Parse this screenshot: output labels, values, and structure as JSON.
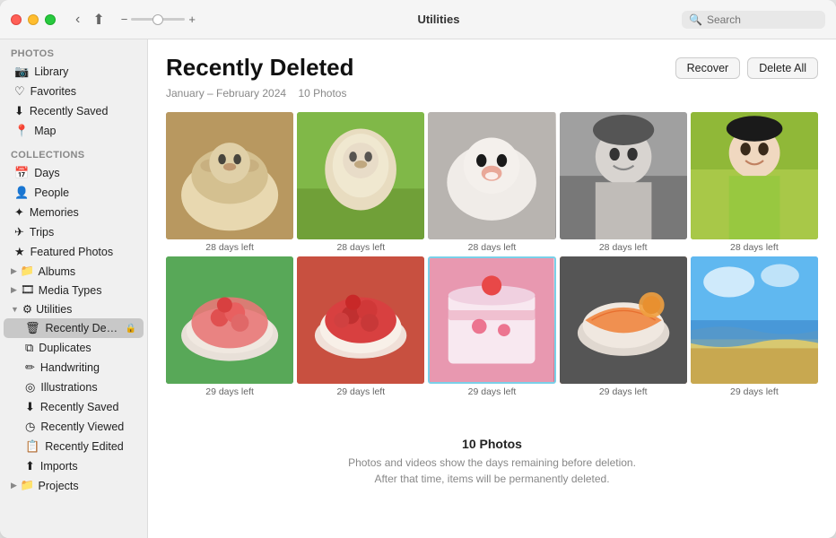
{
  "window": {
    "title": "Utilities"
  },
  "titlebar": {
    "back_btn": "‹",
    "share_btn": "⬆",
    "zoom_minus": "−",
    "zoom_plus": "+",
    "title": "Utilities",
    "search_placeholder": "Search"
  },
  "sidebar": {
    "photos_section": "Photos",
    "collections_section": "Collections",
    "photos_items": [
      {
        "id": "library",
        "icon": "📷",
        "label": "Library"
      },
      {
        "id": "favorites",
        "icon": "♡",
        "label": "Favorites"
      },
      {
        "id": "recently-saved",
        "icon": "⬇",
        "label": "Recently Saved"
      },
      {
        "id": "map",
        "icon": "📍",
        "label": "Map"
      }
    ],
    "collections_items": [
      {
        "id": "days",
        "icon": "📅",
        "label": "Days"
      },
      {
        "id": "people",
        "icon": "👤",
        "label": "People"
      },
      {
        "id": "memories",
        "icon": "✦",
        "label": "Memories"
      },
      {
        "id": "trips",
        "icon": "✈",
        "label": "Trips"
      },
      {
        "id": "featured-photos",
        "icon": "★",
        "label": "Featured Photos"
      },
      {
        "id": "albums",
        "icon": "📁",
        "label": "Albums",
        "has_toggle": true
      },
      {
        "id": "media-types",
        "icon": "🎞",
        "label": "Media Types",
        "has_toggle": true
      },
      {
        "id": "utilities",
        "icon": "⚙",
        "label": "Utilities",
        "expanded": true
      }
    ],
    "utilities_subitems": [
      {
        "id": "recently-deleted",
        "icon": "🗑",
        "label": "Recently Delet...",
        "active": true,
        "has_lock": true
      },
      {
        "id": "duplicates",
        "icon": "⧉",
        "label": "Duplicates"
      },
      {
        "id": "handwriting",
        "icon": "✏",
        "label": "Handwriting"
      },
      {
        "id": "illustrations",
        "icon": "◎",
        "label": "Illustrations"
      },
      {
        "id": "recently-saved-sub",
        "icon": "⬇",
        "label": "Recently Saved"
      },
      {
        "id": "recently-viewed",
        "icon": "◷",
        "label": "Recently Viewed"
      },
      {
        "id": "recently-edited",
        "icon": "📋",
        "label": "Recently Edited"
      },
      {
        "id": "imports",
        "icon": "⬆",
        "label": "Imports"
      }
    ],
    "projects_item": {
      "id": "projects",
      "icon": "📁",
      "label": "Projects",
      "has_toggle": true
    }
  },
  "content": {
    "title": "Recently Deleted",
    "subtitle": "January – February 2024",
    "photo_count_inline": "10 Photos",
    "recover_btn": "Recover",
    "delete_all_btn": "Delete All",
    "photos": [
      {
        "id": "p1",
        "days": "28 days left",
        "color_class": "dog-mop-floor"
      },
      {
        "id": "p2",
        "days": "28 days left",
        "color_class": "dog-mop-green"
      },
      {
        "id": "p3",
        "days": "28 days left",
        "color_class": "dog-mop-gray"
      },
      {
        "id": "p4",
        "days": "28 days left",
        "color_class": "girl-bw"
      },
      {
        "id": "p5",
        "days": "28 days left",
        "color_class": "girl-green"
      },
      {
        "id": "p6",
        "days": "29 days left",
        "color_class": "bowl-green"
      },
      {
        "id": "p7",
        "days": "29 days left",
        "color_class": "bowl-red"
      },
      {
        "id": "p8",
        "days": "29 days left",
        "color_class": "bowl-pink"
      },
      {
        "id": "p9",
        "days": "29 days left",
        "color_class": "bowl-orange"
      },
      {
        "id": "p10",
        "days": "29 days left",
        "color_class": "beach-blue"
      }
    ],
    "bottom_count": "10 Photos",
    "bottom_desc_line1": "Photos and videos show the days remaining before deletion.",
    "bottom_desc_line2": "After that time, items will be permanently deleted."
  }
}
